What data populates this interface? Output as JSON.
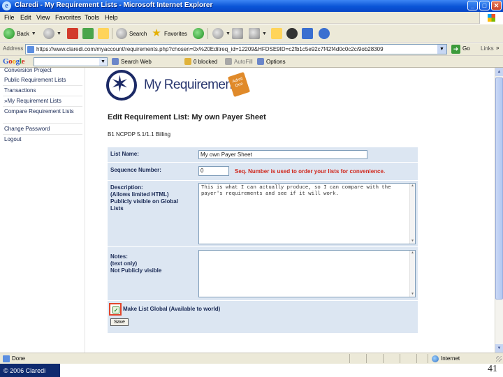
{
  "window": {
    "title": "Claredi - My Requirement Lists - Microsoft Internet Explorer",
    "minimize_glyph": "_",
    "maximize_glyph": "□",
    "close_glyph": "✕"
  },
  "menu": {
    "items": [
      "File",
      "Edit",
      "View",
      "Favorites",
      "Tools",
      "Help"
    ]
  },
  "toolbar": {
    "back_label": "Back",
    "search_label": "Search",
    "favorites_label": "Favorites"
  },
  "address": {
    "label": "Address",
    "url": "https://www.claredi.com/myaccount/requirements.php?chosen=0x%20Editreq_id=12209&HFDSE9ID=c2fb1c5e92c7f42f4d0c0c2c/9ob28309",
    "go_label": "Go",
    "links_label": "Links",
    "links_chevron": "»"
  },
  "googlebar": {
    "logo_letters": [
      "G",
      "o",
      "o",
      "g",
      "l",
      "e"
    ],
    "search_web_label": "Search Web",
    "blocked_label": "0 blocked",
    "autofill_label": "AutoFill",
    "options_label": "Options"
  },
  "sidebar": {
    "items": [
      "Conversion Project",
      "Public Requirement Lists",
      "Transactions",
      "My Requirement Lists",
      "Compare Requirement Lists",
      "Change Password",
      "Logout"
    ],
    "current_marker": "»"
  },
  "logo": {
    "text": "My Requirements",
    "ticket_text": "Admit One"
  },
  "page": {
    "heading": "Edit Requirement List: My own Payer Sheet",
    "subheading": "B1   NCPDP 5.1/1.1   Billing"
  },
  "form": {
    "list_name_label": "List Name:",
    "list_name_value": "My own Payer Sheet",
    "sequence_label": "Sequence Number:",
    "sequence_value": "0",
    "sequence_note": "Seq. Number is used to order your lists for convenience.",
    "description_label": [
      "Description:",
      "(Allows limited HTML)",
      "Publicly visible on Global",
      "Lists"
    ],
    "description_value": "This is what I can actually produce, so I can compare with the payer's requirements and see if it will work.",
    "notes_label": [
      "Notes:",
      "(text only)",
      "Not Publicly visible"
    ],
    "notes_value": "",
    "global_label": "Make List Global (Available to world)",
    "global_checked": true,
    "save_label": "Save"
  },
  "status": {
    "text": "Done",
    "zone": "Internet"
  },
  "slide": {
    "copyright": "© 2006 Claredi",
    "page_number": "41"
  },
  "colors": {
    "title_bar": "#0a54d6",
    "nav_text": "#1a2a55",
    "form_background": "#dce6f2",
    "seq_note": "#d0261b",
    "highlight_box": "#e2452a",
    "footer_bar": "#0f2a6e"
  }
}
